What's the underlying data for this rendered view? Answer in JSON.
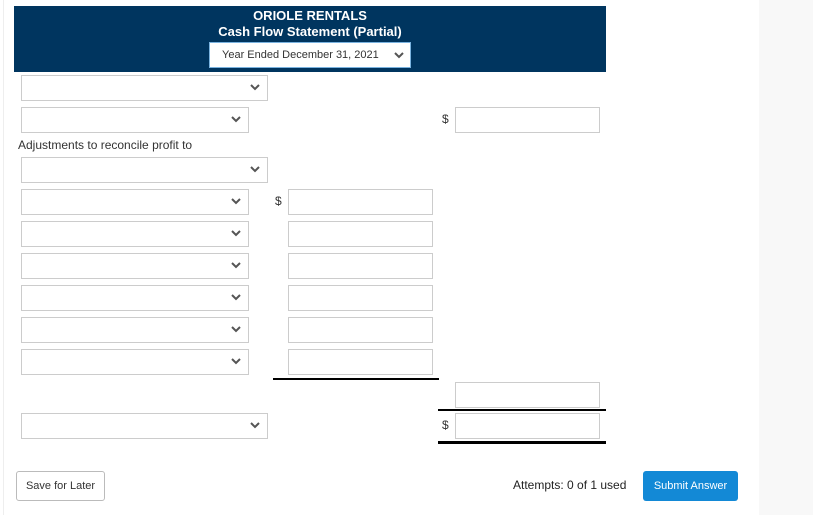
{
  "header": {
    "company": "ORIOLE RENTALS",
    "title": "Cash Flow Statement (Partial)",
    "period_select": {
      "value": "Year Ended December 31, 2021",
      "icon": "chevron-down-icon"
    }
  },
  "rows": {
    "row1_select": {
      "value": ""
    },
    "row2_select": {
      "value": "",
      "currency": "$",
      "amount": ""
    },
    "adjustments_label": "Adjustments to reconcile profit to",
    "row3_select": {
      "value": ""
    },
    "adjustments": [
      {
        "select": "",
        "currency": "$",
        "amount": ""
      },
      {
        "select": "",
        "currency": "",
        "amount": ""
      },
      {
        "select": "",
        "currency": "",
        "amount": ""
      },
      {
        "select": "",
        "currency": "",
        "amount": ""
      },
      {
        "select": "",
        "currency": "",
        "amount": ""
      },
      {
        "select": "",
        "currency": "",
        "amount": ""
      }
    ],
    "subtotal_amount": "",
    "final_select": {
      "value": "",
      "currency": "$",
      "amount": ""
    }
  },
  "footer": {
    "save_label": "Save for Later",
    "attempts_text": "Attempts: 0 of 1 used",
    "submit_label": "Submit Answer"
  },
  "colors": {
    "header_bg": "#00355f",
    "submit_bg": "#1389d6"
  }
}
